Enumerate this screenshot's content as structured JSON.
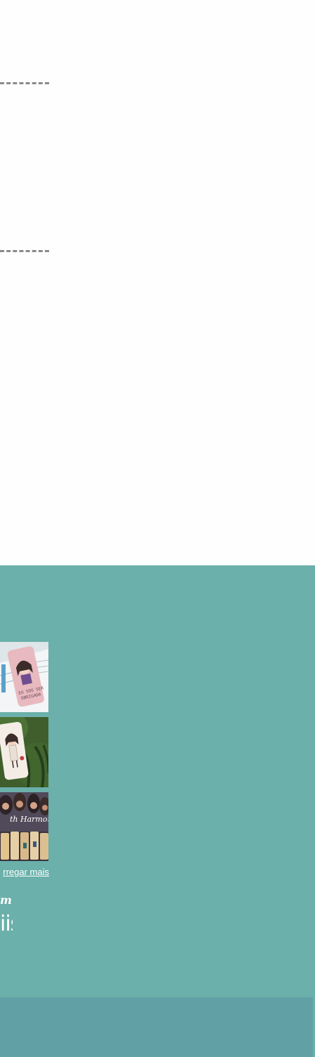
{
  "instagram_feed": {
    "items": [
      {
        "icon": "phone-case-photo-book"
      },
      {
        "icon": "phone-case-photo-watermelon"
      },
      {
        "icon": "phone-case-photo-fifth-harmony"
      }
    ],
    "load_more_label": "rregar mais"
  },
  "footer_script": {
    "line1": "m",
    "line2": "iiş"
  },
  "colors": {
    "teal": "#6bb0aa",
    "footer": "#61a1a5",
    "divider": "#8a8a8a"
  }
}
